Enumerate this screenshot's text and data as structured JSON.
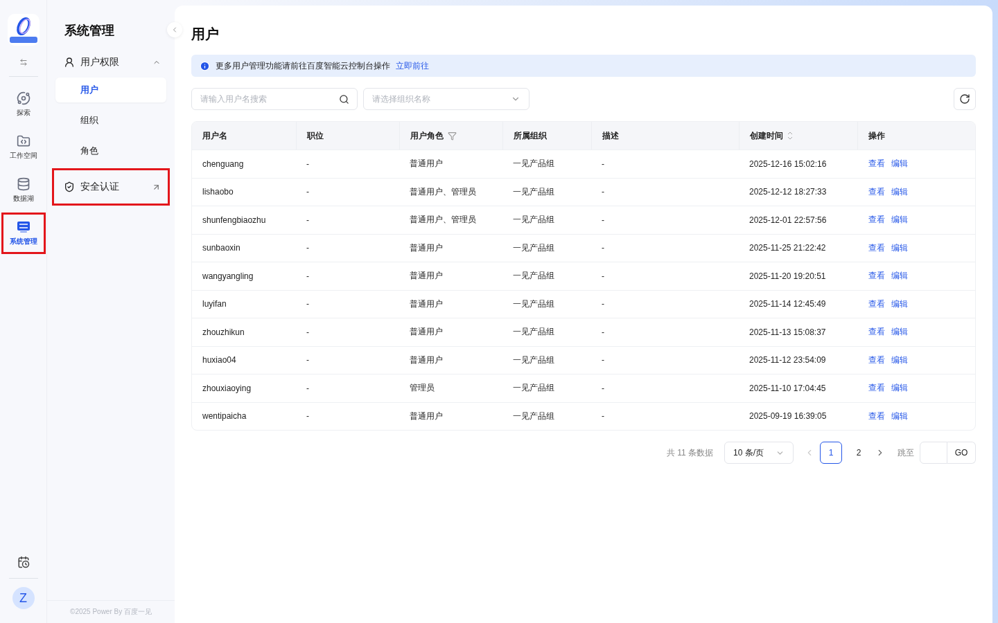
{
  "rail": {
    "items": [
      {
        "label": "探索",
        "selected": false,
        "highlighted": false
      },
      {
        "label": "工作空间",
        "selected": false,
        "highlighted": false
      },
      {
        "label": "数据湖",
        "selected": false,
        "highlighted": false
      },
      {
        "label": "系统管理",
        "selected": true,
        "highlighted": true
      }
    ],
    "avatar": "Z"
  },
  "sidebar": {
    "title": "系统管理",
    "groups": [
      {
        "label": "用户权限",
        "kind": "group",
        "expanded": true,
        "highlighted": false,
        "children": [
          {
            "label": "用户",
            "selected": true
          },
          {
            "label": "组织",
            "selected": false
          },
          {
            "label": "角色",
            "selected": false
          }
        ]
      },
      {
        "label": "安全认证",
        "kind": "external",
        "highlighted": true
      }
    ],
    "footer": "©2025 Power By 百度一见"
  },
  "page": {
    "title": "用户",
    "notice": {
      "text": "更多用户管理功能请前往百度智能云控制台操作",
      "link": "立即前往"
    },
    "search": {
      "placeholder": "请输入用户名搜索"
    },
    "org_select": {
      "placeholder": "请选择组织名称"
    }
  },
  "table": {
    "columns": [
      {
        "label": "用户名",
        "kind": "plain"
      },
      {
        "label": "职位",
        "kind": "plain"
      },
      {
        "label": "用户角色",
        "kind": "filter"
      },
      {
        "label": "所属组织",
        "kind": "plain"
      },
      {
        "label": "描述",
        "kind": "plain"
      },
      {
        "label": "创建时间",
        "kind": "sort"
      },
      {
        "label": "操作",
        "kind": "plain"
      }
    ],
    "rows": [
      {
        "cells": [
          "chenguang",
          "-",
          "普通用户",
          "一见产品组",
          "-",
          "2025-12-16 15:02:16"
        ],
        "actions": [
          "查看",
          "编辑"
        ]
      },
      {
        "cells": [
          "lishaobo",
          "-",
          "普通用户、管理员",
          "一见产品组",
          "-",
          "2025-12-12 18:27:33"
        ],
        "actions": [
          "查看",
          "编辑"
        ]
      },
      {
        "cells": [
          "shunfengbiaozhu",
          "-",
          "普通用户、管理员",
          "一见产品组",
          "-",
          "2025-12-01 22:57:56"
        ],
        "actions": [
          "查看",
          "编辑"
        ]
      },
      {
        "cells": [
          "sunbaoxin",
          "-",
          "普通用户",
          "一见产品组",
          "-",
          "2025-11-25 21:22:42"
        ],
        "actions": [
          "查看",
          "编辑"
        ]
      },
      {
        "cells": [
          "wangyangling",
          "-",
          "普通用户",
          "一见产品组",
          "-",
          "2025-11-20 19:20:51"
        ],
        "actions": [
          "查看",
          "编辑"
        ]
      },
      {
        "cells": [
          "luyifan",
          "-",
          "普通用户",
          "一见产品组",
          "-",
          "2025-11-14 12:45:49"
        ],
        "actions": [
          "查看",
          "编辑"
        ]
      },
      {
        "cells": [
          "zhouzhikun",
          "-",
          "普通用户",
          "一见产品组",
          "-",
          "2025-11-13 15:08:37"
        ],
        "actions": [
          "查看",
          "编辑"
        ]
      },
      {
        "cells": [
          "huxiao04",
          "-",
          "普通用户",
          "一见产品组",
          "-",
          "2025-11-12 23:54:09"
        ],
        "actions": [
          "查看",
          "编辑"
        ]
      },
      {
        "cells": [
          "zhouxiaoying",
          "-",
          "管理员",
          "一见产品组",
          "-",
          "2025-11-10 17:04:45"
        ],
        "actions": [
          "查看",
          "编辑"
        ]
      },
      {
        "cells": [
          "wentipaicha",
          "-",
          "普通用户",
          "一见产品组",
          "-",
          "2025-09-19 16:39:05"
        ],
        "actions": [
          "查看",
          "编辑"
        ]
      }
    ]
  },
  "pagination": {
    "total": "共 11 条数据",
    "page_size": "10 条/页",
    "pages": [
      {
        "label": "1",
        "selected": true
      },
      {
        "label": "2",
        "selected": false
      }
    ],
    "jump_label": "跳至",
    "go": "GO"
  }
}
